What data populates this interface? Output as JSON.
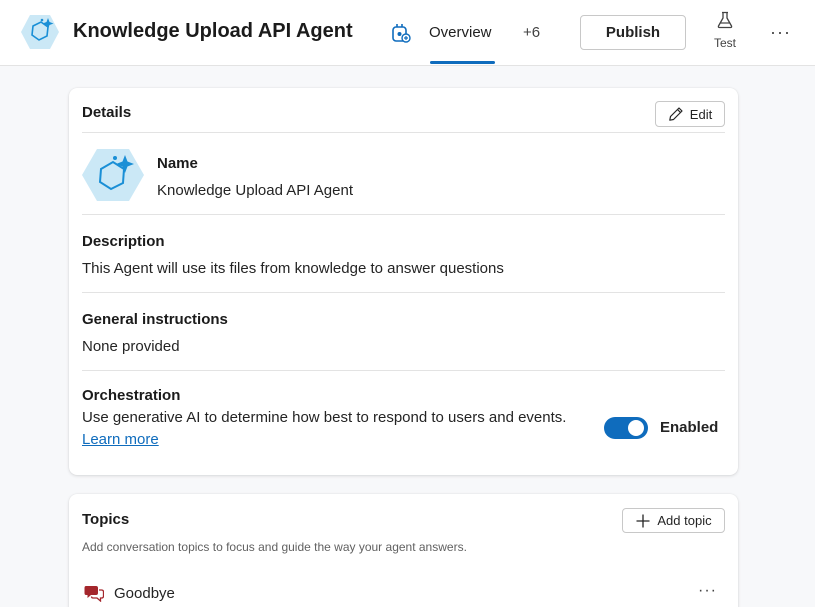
{
  "header": {
    "agent_name": "Knowledge Upload API Agent",
    "tabs": [
      {
        "label": "Overview",
        "selected": true
      },
      {
        "label": "+6",
        "selected": false
      }
    ],
    "publish_label": "Publish",
    "test_label": "Test",
    "more_label": "···"
  },
  "details": {
    "title": "Details",
    "edit_label": "Edit",
    "name_label": "Name",
    "name_value": "Knowledge Upload API Agent",
    "description_label": "Description",
    "description_value": "This Agent will use its files from knowledge to answer questions",
    "instructions_label": "General instructions",
    "instructions_value": "None provided",
    "orchestration_label": "Orchestration",
    "orchestration_value": "Use generative AI to determine how best to respond to users and events.",
    "learn_more_label": "Learn more",
    "toggle_label": "Enabled",
    "toggle_on": true
  },
  "topics": {
    "title": "Topics",
    "add_label": "Add topic",
    "description": "Add conversation topics to focus and guide the way your agent answers.",
    "items": [
      {
        "name": "Goodbye",
        "icon": "chat-bubbles-icon"
      }
    ],
    "more_label": "···"
  },
  "colors": {
    "accent": "#0f6cbd",
    "logo_fill": "#cbe8f6",
    "logo_stroke": "#1a8fd6",
    "topic_icon": "#a4262c"
  }
}
